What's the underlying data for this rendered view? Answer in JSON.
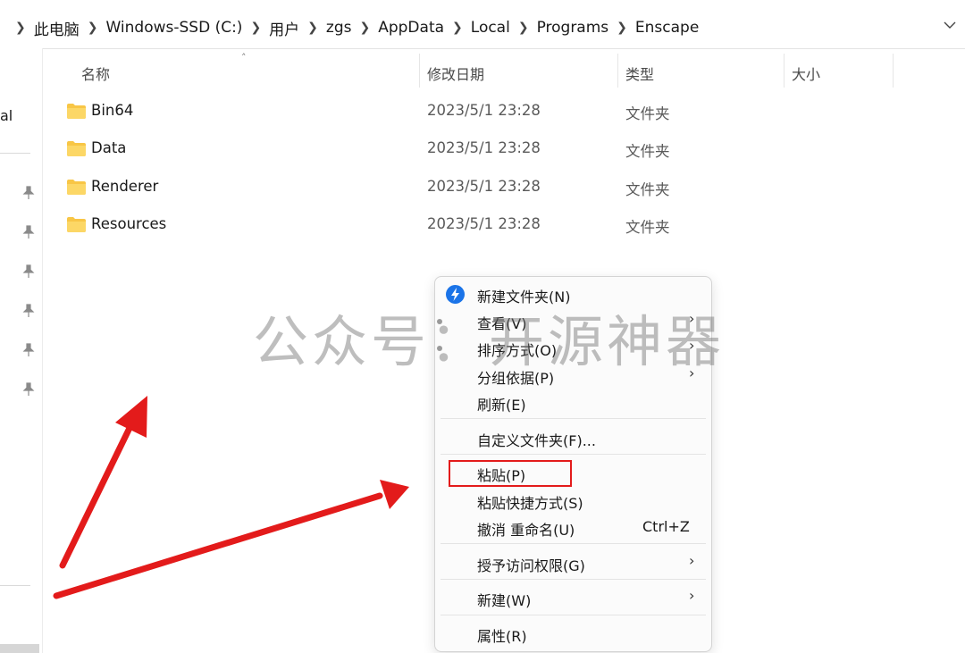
{
  "breadcrumb": [
    "此电脑",
    "Windows-SSD (C:)",
    "用户",
    "zgs",
    "AppData",
    "Local",
    "Programs",
    "Enscape"
  ],
  "left_pane": {
    "partial_label": "al"
  },
  "columns": {
    "name": "名称",
    "modified": "修改日期",
    "type": "类型",
    "size": "大小"
  },
  "files": [
    {
      "name": "Bin64",
      "modified": "2023/5/1 23:28",
      "type": "文件夹"
    },
    {
      "name": "Data",
      "modified": "2023/5/1 23:28",
      "type": "文件夹"
    },
    {
      "name": "Renderer",
      "modified": "2023/5/1 23:28",
      "type": "文件夹"
    },
    {
      "name": "Resources",
      "modified": "2023/5/1 23:28",
      "type": "文件夹"
    }
  ],
  "context_menu": {
    "new_folder": "新建文件夹(N)",
    "view": "查看(V)",
    "sort": "排序方式(O)",
    "group": "分组依据(P)",
    "refresh": "刷新(E)",
    "customize": "自定义文件夹(F)...",
    "paste": "粘贴(P)",
    "paste_shortcut": "粘贴快捷方式(S)",
    "undo": "撤消 重命名(U)",
    "undo_shortcut": "Ctrl+Z",
    "grant_access": "授予访问权限(G)",
    "new": "新建(W)",
    "properties": "属性(R)"
  },
  "watermark": "公众号：开源神器",
  "colors": {
    "highlight_box": "#e31b1b",
    "arrow": "#e31b1b",
    "folder": "#f8c646",
    "new_folder_icon": "#1b74e8"
  }
}
